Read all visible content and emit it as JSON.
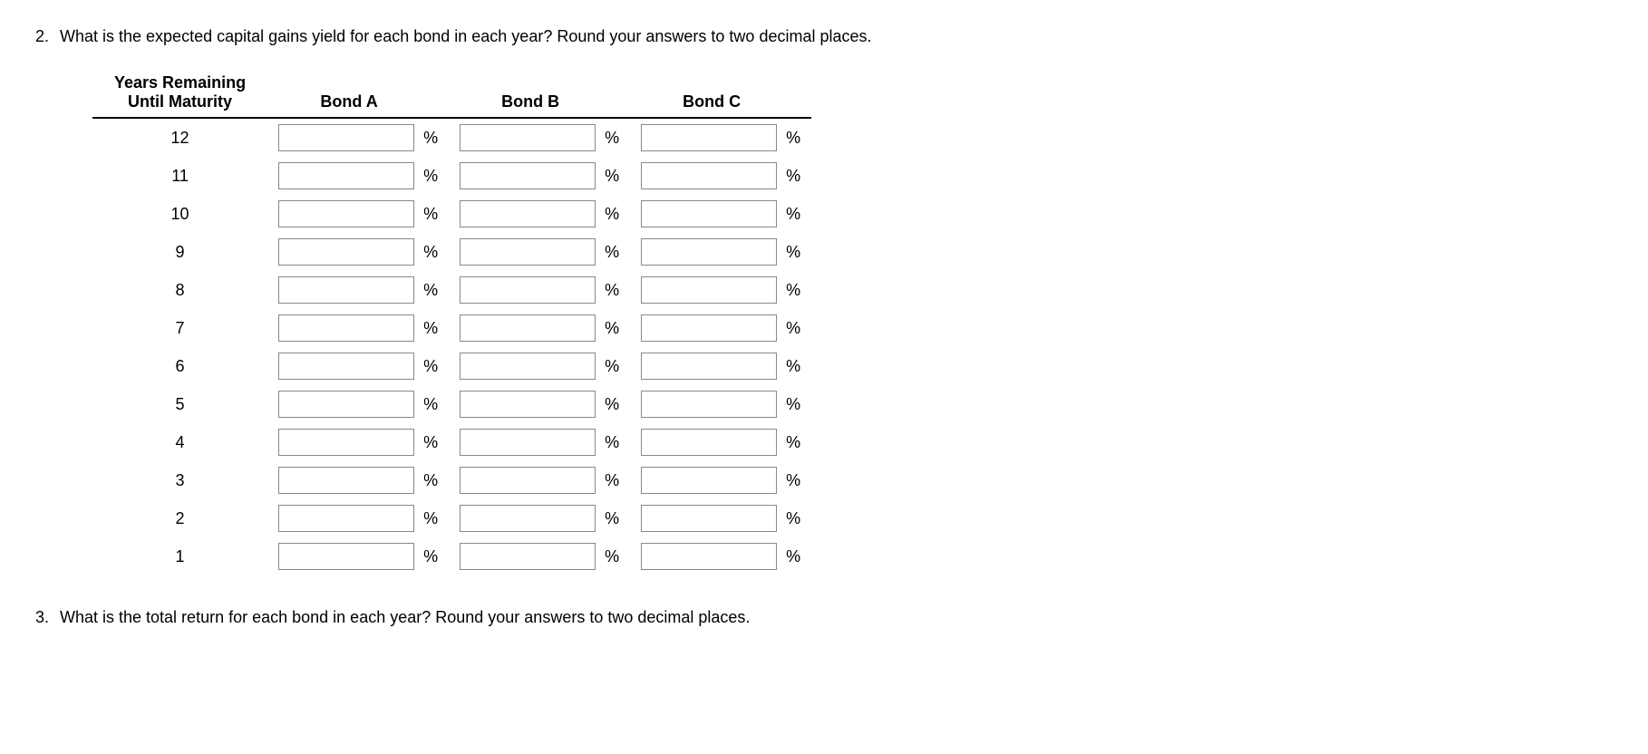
{
  "question2": {
    "number": "2.",
    "text": "What is the expected capital gains yield for each bond in each year? Round your answers to two decimal places."
  },
  "question3": {
    "number": "3.",
    "text": "What is the total return for each bond in each year? Round your answers to two decimal places."
  },
  "table": {
    "header_years_line1": "Years Remaining",
    "header_years_line2": "Until Maturity",
    "header_bond_a": "Bond A",
    "header_bond_b": "Bond B",
    "header_bond_c": "Bond C",
    "percent_symbol": "%",
    "years": [
      "12",
      "11",
      "10",
      "9",
      "8",
      "7",
      "6",
      "5",
      "4",
      "3",
      "2",
      "1"
    ]
  }
}
